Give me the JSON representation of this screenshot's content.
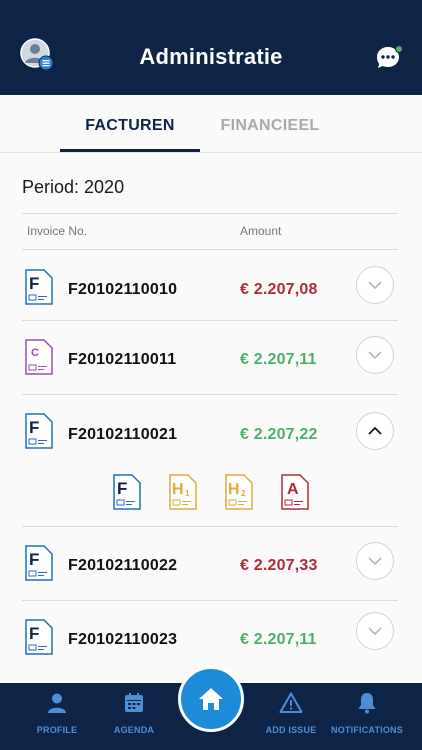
{
  "header": {
    "title": "Administratie"
  },
  "tabs": [
    {
      "label": "FACTUREN",
      "active": true
    },
    {
      "label": "FINANCIEEL",
      "active": false
    }
  ],
  "period": "Period: 2020",
  "columns": {
    "invoice": "Invoice No.",
    "amount": "Amount"
  },
  "invoices": [
    {
      "number": "F20102110010",
      "amount": "€ 2.207,08",
      "status": "red",
      "doc_letter": "F",
      "doc_color": "#1f6fbf",
      "expanded": false
    },
    {
      "number": "F20102110011",
      "amount": "€ 2.207,11",
      "status": "green",
      "doc_letter": "C",
      "doc_color": "#9a4fb5",
      "expanded": false
    },
    {
      "number": "F20102110021",
      "amount": "€ 2.207,22",
      "status": "green",
      "doc_letter": "F",
      "doc_color": "#1f6fbf",
      "expanded": true
    },
    {
      "number": "F20102110022",
      "amount": "€ 2.207,33",
      "status": "red",
      "doc_letter": "F",
      "doc_color": "#1f6fbf",
      "expanded": false
    },
    {
      "number": "F20102110023",
      "amount": "€ 2.207,11",
      "status": "green",
      "doc_letter": "F",
      "doc_color": "#1f6fbf",
      "expanded": false
    }
  ],
  "sub_documents": [
    {
      "letter": "F",
      "sub": "",
      "color": "#1f6fbf"
    },
    {
      "letter": "H",
      "sub": "1",
      "color": "#e2a93b"
    },
    {
      "letter": "H",
      "sub": "2",
      "color": "#e2a93b"
    },
    {
      "letter": "A",
      "sub": "",
      "color": "#b32a36"
    }
  ],
  "tabbar": {
    "profile": "PROFILE",
    "agenda": "AGENDA",
    "add_issue": "ADD ISSUE",
    "notifications": "NOTIFICATIONS"
  },
  "colors": {
    "navy": "#0d2447",
    "accent_blue": "#1e8bd8",
    "tab_label_blue": "#4d8fd6",
    "amount_red": "#b32a36",
    "amount_green": "#4caf6a",
    "status_dot": "#4caf6a"
  },
  "icons": [
    "avatar-icon",
    "chat-icon",
    "chevron-down-icon",
    "chevron-up-icon",
    "profile-icon",
    "calendar-icon",
    "home-icon",
    "warning-icon",
    "bell-icon"
  ]
}
